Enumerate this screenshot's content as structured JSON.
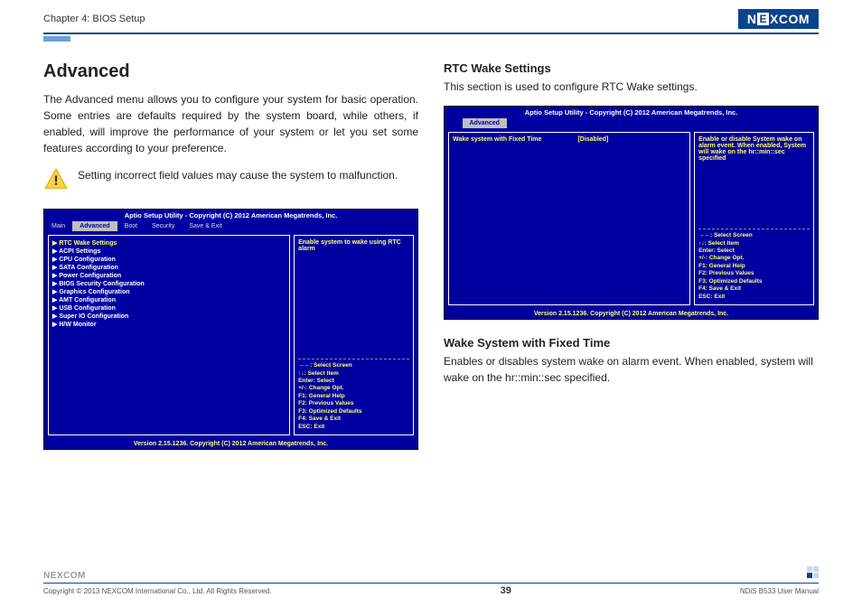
{
  "header": {
    "chapter": "Chapter 4: BIOS Setup",
    "logo_text": "NEXCOM"
  },
  "left": {
    "title": "Advanced",
    "intro": "The Advanced menu allows you to configure your system for basic operation. Some entries are defaults required by the system board, while others, if enabled, will improve the performance of your system or let you set some features according to your preference.",
    "warning": "Setting incorrect field values may cause the system to malfunction.",
    "bios": {
      "title": "Aptio Setup Utility - Copyright (C) 2012 American Megatrends, Inc.",
      "tabs": [
        "Main",
        "Advanced",
        "Boot",
        "Security",
        "Save & Exit"
      ],
      "active_tab": "Advanced",
      "menu": [
        "▶ RTC Wake Settings",
        "▶ ACPI Settings",
        "▶ CPU Configuration",
        "▶ SATA Configuration",
        "▶ Power Configuration",
        "▶ BIOS Security Configuration",
        "▶ Graphics Configuration",
        "▶ AMT Configuration",
        "▶ USB Configuration",
        "▶ Super IO Configuration",
        "▶ H/W Monitor"
      ],
      "help": "Enable system to wake using RTC alarm",
      "keys": "→←: Select Screen\n↑↓: Select Item\nEnter: Select\n+/-: Change Opt.\nF1: General Help\nF2: Previous Values\nF3: Optimized Defaults\nF4: Save & Exit\nESC: Exit",
      "version": "Version 2.15.1236. Copyright (C) 2012 American Megatrends, Inc."
    }
  },
  "right": {
    "section_title": "RTC Wake Settings",
    "section_desc": "This section is used to configure RTC Wake settings.",
    "bios": {
      "title": "Aptio Setup Utility - Copyright (C) 2012 American Megatrends, Inc.",
      "active_tab": "Advanced",
      "setting_label": "Wake system with Fixed Time",
      "setting_value": "[Disabled]",
      "help": "Enable or disable System wake on alarm event. When enabled, System will wake on the hr::min::sec specified",
      "keys": "→←: Select Screen\n↑↓: Select Item\nEnter: Select\n+/-: Change Opt.\nF1: General Help\nF2: Previous Values\nF3: Optimized Defaults\nF4: Save & Exit\nESC: Exit",
      "version": "Version 2.15.1236. Copyright (C) 2012 American Megatrends, Inc."
    },
    "sub_title": "Wake System with Fixed Time",
    "sub_desc": "Enables or disables system wake on alarm event. When enabled, system will wake on the hr::min::sec specified."
  },
  "footer": {
    "copyright": "Copyright © 2013 NEXCOM International Co., Ltd. All Rights Reserved.",
    "page": "39",
    "manual": "NDiS B533 User Manual",
    "logo": "NEXCOM"
  }
}
